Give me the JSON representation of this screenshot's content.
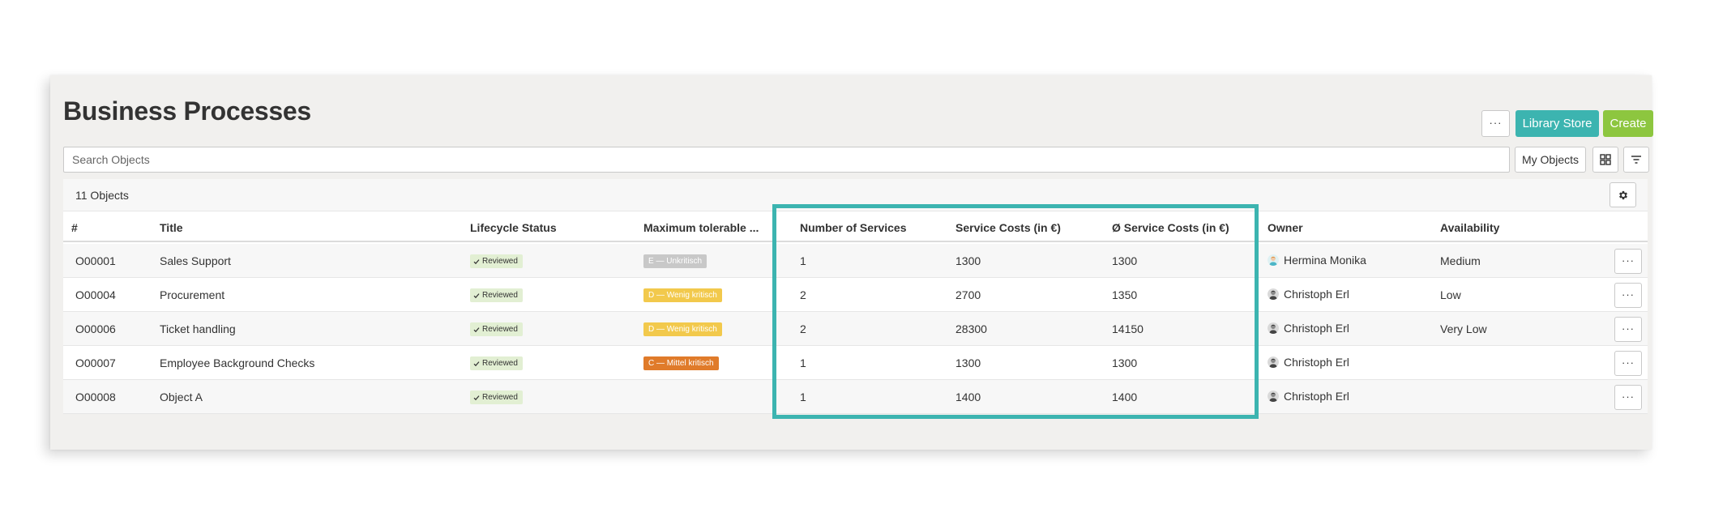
{
  "page": {
    "title": "Business Processes"
  },
  "toolbar": {
    "more_label": "···",
    "library_label": "Library Store",
    "create_label": "Create",
    "library_color": "#3cb4b0",
    "create_color": "#8dc63f"
  },
  "search": {
    "placeholder": "Search Objects",
    "value": ""
  },
  "filters": {
    "my_objects_label": "My Objects",
    "grid_icon": "grid-icon",
    "filter_icon": "filter-icon"
  },
  "table": {
    "count_label": "11 Objects",
    "settings_icon": "gear-icon",
    "headers": {
      "id": "#",
      "title": "Title",
      "lifecycle": "Lifecycle Status",
      "max": "Maximum tolerable ...",
      "num_services": "Number of Services",
      "service_costs": "Service Costs (in €)",
      "avg_service_costs": "Ø Service Costs (in €)",
      "owner": "Owner",
      "availability": "Availability"
    },
    "rows": [
      {
        "id": "O00001",
        "title": "Sales Support",
        "lifecycle": "Reviewed",
        "max": "E — Unkritisch",
        "max_color": "#c8c8c8",
        "num_services": "1",
        "service_costs": "1300",
        "avg_service_costs": "1300",
        "owner": "Hermina Monika",
        "availability": "Medium",
        "more": "···"
      },
      {
        "id": "O00004",
        "title": "Procurement",
        "lifecycle": "Reviewed",
        "max": "D — Wenig kritisch",
        "max_color": "#f2c94c",
        "num_services": "2",
        "service_costs": "2700",
        "avg_service_costs": "1350",
        "owner": "Christoph Erl",
        "availability": "Low",
        "more": "···"
      },
      {
        "id": "O00006",
        "title": "Ticket handling",
        "lifecycle": "Reviewed",
        "max": "D — Wenig kritisch",
        "max_color": "#f2c94c",
        "num_services": "2",
        "service_costs": "28300",
        "avg_service_costs": "14150",
        "owner": "Christoph Erl",
        "availability": "Very Low",
        "more": "···"
      },
      {
        "id": "O00007",
        "title": "Employee Background Checks",
        "lifecycle": "Reviewed",
        "max": "C — Mittel kritisch",
        "max_color": "#e07b2a",
        "num_services": "1",
        "service_costs": "1300",
        "avg_service_costs": "1300",
        "owner": "Christoph Erl",
        "availability": "",
        "more": "···"
      },
      {
        "id": "O00008",
        "title": "Object A",
        "lifecycle": "Reviewed",
        "max": "",
        "max_color": "",
        "num_services": "1",
        "service_costs": "1400",
        "avg_service_costs": "1400",
        "owner": "Christoph Erl",
        "availability": "",
        "more": "···"
      }
    ]
  },
  "highlight": {
    "color": "#3cb4b0"
  }
}
